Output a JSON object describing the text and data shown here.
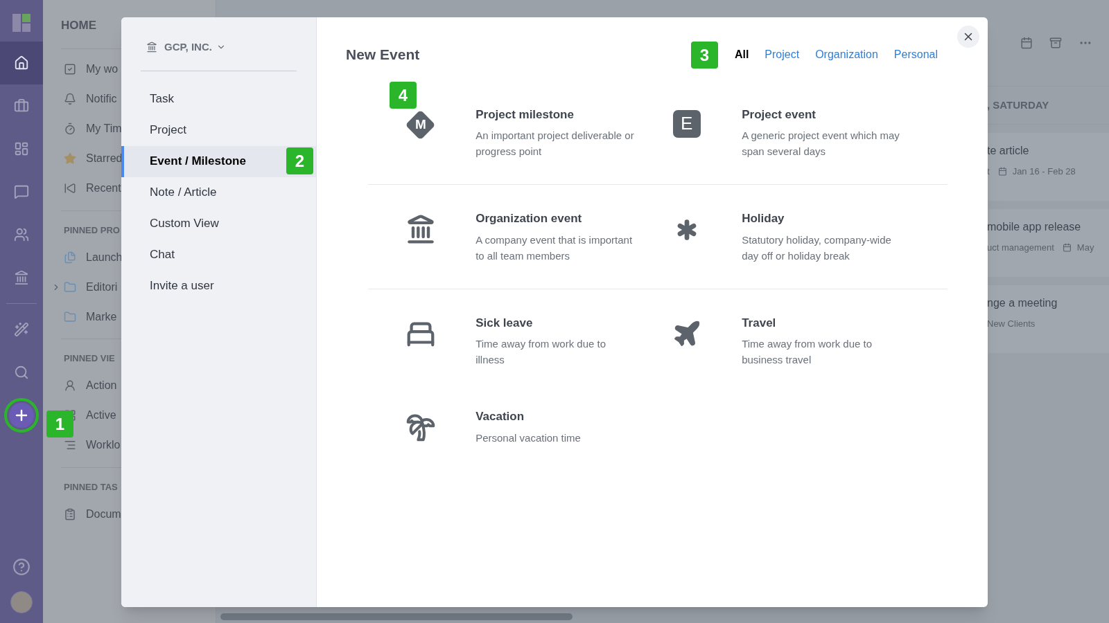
{
  "rail": {
    "items": [
      {
        "selected": true
      },
      {
        "selected": false
      },
      {
        "selected": false
      },
      {
        "selected": false
      },
      {
        "selected": false
      },
      {
        "selected": false
      },
      {
        "selected": false
      },
      {
        "selected": false
      },
      {
        "selected": false
      }
    ]
  },
  "sidebar": {
    "title": "HOME",
    "sections": [
      {
        "items": [
          {
            "label": "My wo"
          },
          {
            "label": "Notific"
          },
          {
            "label": "My Tim"
          },
          {
            "label": "Starred"
          },
          {
            "label": "Recent"
          }
        ]
      },
      {
        "heading": "PINNED PRO",
        "items": [
          {
            "label": "Launch"
          },
          {
            "label": "Editori",
            "expanded": false
          },
          {
            "label": "Marke"
          }
        ]
      },
      {
        "heading": "PINNED VIE",
        "items": [
          {
            "label": "Action"
          },
          {
            "label": "Active"
          },
          {
            "label": "Worklo"
          }
        ]
      },
      {
        "heading": "PINNED TAS",
        "items": [
          {
            "label": "Docum"
          }
        ]
      }
    ]
  },
  "main": {
    "day_header": ", SATURDAY",
    "cards": [
      {
        "title": "te article",
        "meta": "t",
        "date": "Jan 16 - Feb 28"
      },
      {
        "title": "mobile app release",
        "meta": "uct management",
        "date": "May"
      },
      {
        "title": "nge a meeting",
        "meta": "New Clients"
      }
    ]
  },
  "modal": {
    "org": "GCP, INC.",
    "menu": [
      {
        "label": "Task",
        "selected": false
      },
      {
        "label": "Project",
        "selected": false
      },
      {
        "label": "Event / Milestone",
        "selected": true
      },
      {
        "label": "Note / Article",
        "selected": false
      },
      {
        "label": "Custom View",
        "selected": false
      },
      {
        "label": "Chat",
        "selected": false
      },
      {
        "label": "Invite a user",
        "selected": false
      }
    ],
    "title": "New Event",
    "filters": [
      {
        "label": "All",
        "selected": true
      },
      {
        "label": "Project",
        "selected": false
      },
      {
        "label": "Organization",
        "selected": false
      },
      {
        "label": "Personal",
        "selected": false
      }
    ],
    "event_groups": [
      [
        {
          "kind": "milestone",
          "icon_text": "M",
          "title": "Project milestone",
          "description": "An important project deliverable or progress point"
        },
        {
          "kind": "letter",
          "icon_text": "E",
          "title": "Project event",
          "description": "A generic project event which may span several days"
        }
      ],
      [
        {
          "kind": "bank",
          "title": "Organization event",
          "description": "A company event that is important to all team members"
        },
        {
          "kind": "asterisk",
          "title": "Holiday",
          "description": "Statutory holiday, company-wide day off or holiday break"
        }
      ],
      [
        {
          "kind": "bed",
          "title": "Sick leave",
          "description": "Time away from work due to illness"
        },
        {
          "kind": "plane",
          "title": "Travel",
          "description": "Time away from work due to business travel"
        },
        {
          "kind": "palm",
          "title": "Vacation",
          "description": "Personal vacation time"
        }
      ]
    ]
  },
  "callouts": [
    "1",
    "2",
    "3",
    "4"
  ]
}
